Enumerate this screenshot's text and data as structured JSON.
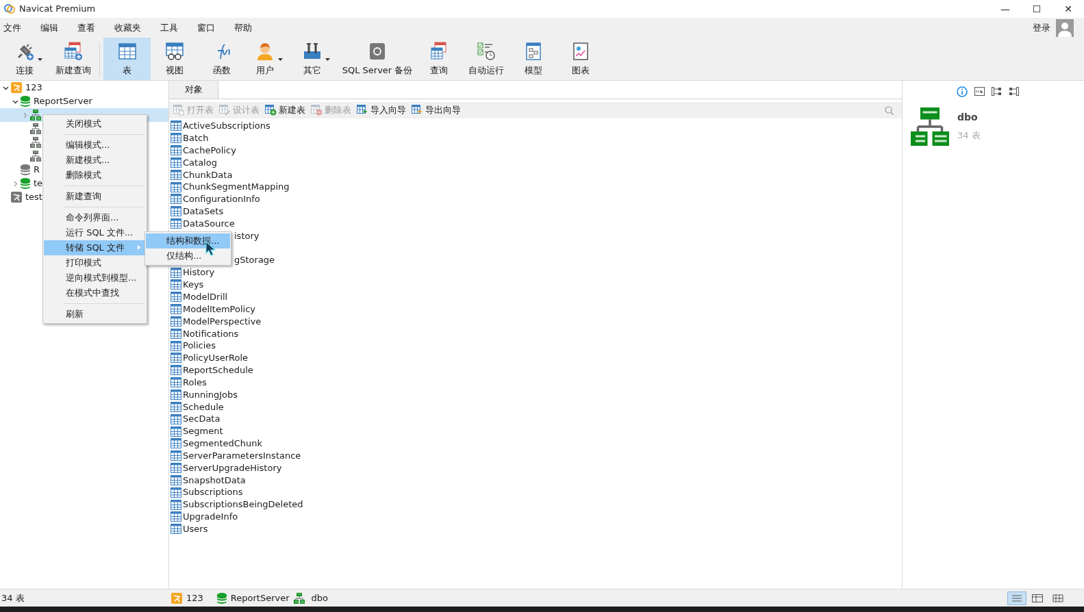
{
  "window": {
    "title": "Navicat Premium",
    "controls": [
      "—",
      "☐",
      "✕"
    ]
  },
  "menu_bar": [
    "文件",
    "编辑",
    "查看",
    "收藏夹",
    "工具",
    "窗口",
    "帮助"
  ],
  "login": "登录",
  "toolbar": [
    {
      "label": "连接",
      "kind": "connect",
      "dropdown": true,
      "selected": false
    },
    {
      "label": "新建查询",
      "kind": "newquery",
      "dropdown": false,
      "selected": false
    },
    {
      "label": "表",
      "kind": "table",
      "dropdown": false,
      "selected": true
    },
    {
      "label": "视图",
      "kind": "view",
      "dropdown": false,
      "selected": false
    },
    {
      "label": "函数",
      "kind": "function",
      "dropdown": false,
      "selected": false
    },
    {
      "label": "用户",
      "kind": "user",
      "dropdown": true,
      "selected": false
    },
    {
      "label": "其它",
      "kind": "tools",
      "dropdown": true,
      "selected": false
    },
    {
      "label": "SQL Server 备份",
      "kind": "backup",
      "dropdown": false,
      "selected": false
    },
    {
      "label": "查询",
      "kind": "query",
      "dropdown": false,
      "selected": false
    },
    {
      "label": "自动运行",
      "kind": "auto",
      "dropdown": false,
      "selected": false
    },
    {
      "label": "模型",
      "kind": "model",
      "dropdown": false,
      "selected": false
    },
    {
      "label": "图表",
      "kind": "chart",
      "dropdown": false,
      "selected": false
    }
  ],
  "tree": [
    {
      "label": "123",
      "kind": "server",
      "expanded": true,
      "selected": false,
      "children": [
        {
          "label": "ReportServer",
          "kind": "database",
          "expanded": true,
          "selected": false,
          "children": [
            {
              "kind": "schema",
              "expanded": false,
              "selected": true
            },
            {
              "kind": "schema-gray",
              "selected": false
            },
            {
              "kind": "schema-gray",
              "selected": false
            },
            {
              "kind": "schema-gray",
              "selected": false
            }
          ]
        },
        {
          "label": "R",
          "kind": "database-gray",
          "selected": false
        },
        {
          "label": "te",
          "kind": "database",
          "expanded": false,
          "selected": false
        }
      ]
    },
    {
      "label": "test",
      "kind": "server-gray",
      "selected": false
    }
  ],
  "tab": {
    "label": "对象",
    "selected": true
  },
  "object_toolbar": [
    {
      "label": "打开表",
      "kind": "open",
      "disabled": true
    },
    {
      "label": "设计表",
      "kind": "design",
      "disabled": true
    },
    {
      "label": "新建表",
      "kind": "new",
      "disabled": false
    },
    {
      "label": "删除表",
      "kind": "delete",
      "disabled": true
    },
    {
      "label": "导入向导",
      "kind": "import",
      "disabled": false
    },
    {
      "label": "导出向导",
      "kind": "export",
      "disabled": false
    }
  ],
  "tables": [
    {
      "kind": "full",
      "label": "ActiveSubscriptions"
    },
    {
      "kind": "full",
      "label": "Batch"
    },
    {
      "kind": "full",
      "label": "CachePolicy"
    },
    {
      "kind": "full",
      "label": "Catalog"
    },
    {
      "kind": "full",
      "label": "ChunkData"
    },
    {
      "kind": "full",
      "label": "ChunkSegmentMapping"
    },
    {
      "kind": "full",
      "label": "ConfigurationInfo"
    },
    {
      "kind": "full",
      "label": "DataSets"
    },
    {
      "kind": "full",
      "label": "DataSource"
    },
    {
      "kind": "partial",
      "label": "istory"
    },
    {
      "kind": "hidden"
    },
    {
      "kind": "partial",
      "label": "gStorage"
    },
    {
      "kind": "full",
      "label": "History"
    },
    {
      "kind": "full",
      "label": "Keys"
    },
    {
      "kind": "full",
      "label": "ModelDrill"
    },
    {
      "kind": "full",
      "label": "ModelItemPolicy"
    },
    {
      "kind": "full",
      "label": "ModelPerspective"
    },
    {
      "kind": "full",
      "label": "Notifications"
    },
    {
      "kind": "full",
      "label": "Policies"
    },
    {
      "kind": "full",
      "label": "PolicyUserRole"
    },
    {
      "kind": "full",
      "label": "ReportSchedule"
    },
    {
      "kind": "full",
      "label": "Roles"
    },
    {
      "kind": "full",
      "label": "RunningJobs"
    },
    {
      "kind": "full",
      "label": "Schedule"
    },
    {
      "kind": "full",
      "label": "SecData"
    },
    {
      "kind": "full",
      "label": "Segment"
    },
    {
      "kind": "full",
      "label": "SegmentedChunk"
    },
    {
      "kind": "full",
      "label": "ServerParametersInstance"
    },
    {
      "kind": "full",
      "label": "ServerUpgradeHistory"
    },
    {
      "kind": "full",
      "label": "SnapshotData"
    },
    {
      "kind": "full",
      "label": "Subscriptions"
    },
    {
      "kind": "full",
      "label": "SubscriptionsBeingDeleted"
    },
    {
      "kind": "full",
      "label": "UpgradeInfo"
    },
    {
      "kind": "full",
      "label": "Users"
    }
  ],
  "info_panel": {
    "name": "dbo",
    "count": "34 表"
  },
  "context_menu": [
    {
      "kind": "item",
      "label": "关闭模式",
      "selected": false
    },
    {
      "kind": "separator"
    },
    {
      "kind": "item",
      "label": "编辑模式...",
      "selected": false
    },
    {
      "kind": "item",
      "label": "新建模式...",
      "selected": false
    },
    {
      "kind": "item",
      "label": "删除模式",
      "selected": false
    },
    {
      "kind": "separator"
    },
    {
      "kind": "item",
      "label": "新建查询",
      "selected": false
    },
    {
      "kind": "separator"
    },
    {
      "kind": "item",
      "label": "命令列界面...",
      "selected": false
    },
    {
      "kind": "item",
      "label": "运行 SQL 文件...",
      "selected": false
    },
    {
      "kind": "submenu",
      "label": "转储 SQL 文件",
      "selected": true
    },
    {
      "kind": "item",
      "label": "打印模式",
      "selected": false
    },
    {
      "kind": "item",
      "label": "逆向模式到模型...",
      "selected": false
    },
    {
      "kind": "item",
      "label": "在模式中查找",
      "selected": false
    },
    {
      "kind": "separator"
    },
    {
      "kind": "item",
      "label": "刷新",
      "selected": false
    }
  ],
  "submenu": [
    {
      "label": "结构和数据...",
      "selected": true
    },
    {
      "label": "仅结构...",
      "selected": false
    }
  ],
  "status_bar": {
    "left": "34 表",
    "connection": "123",
    "database": "ReportServer",
    "schema": "dbo"
  },
  "view_modes": [
    {
      "kind": "list",
      "selected": true
    },
    {
      "kind": "detail",
      "selected": false
    },
    {
      "kind": "grid",
      "selected": false
    }
  ]
}
